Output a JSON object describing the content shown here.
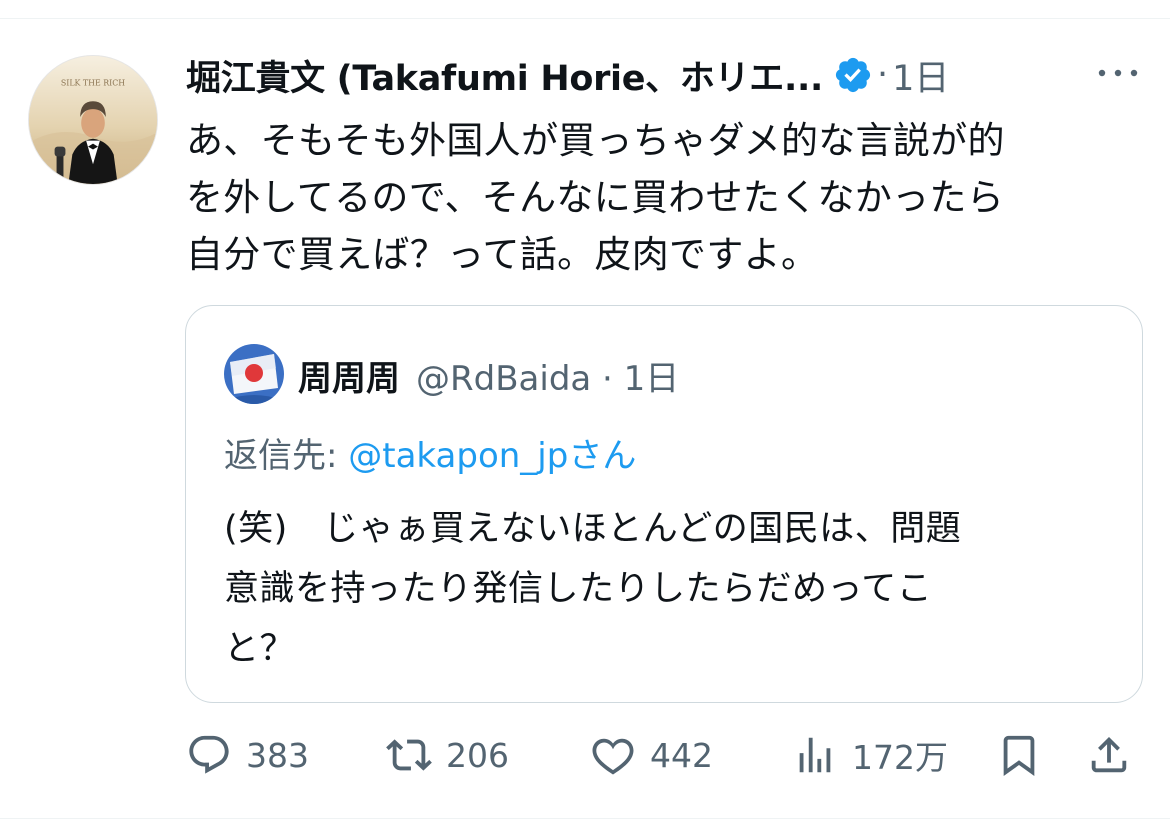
{
  "tweet": {
    "author_name": "堀江貴文 (Takafumi Horie、ホリエ...",
    "separator": "·",
    "time": "1日",
    "text": "あ、そもそも外国人が買っちゃダメ的な言説が的\nを外してるので、そんなに買わせたくなかったら\n自分で買えば？って話。皮肉ですよ。",
    "avatar_caption": "SILK THE RICH"
  },
  "quote": {
    "author_name": "周周周",
    "handle_time": "@RdBaida · 1日",
    "reply_prefix": "返信先: ",
    "reply_mention": "@takapon_jpさん",
    "text": "(笑)　じゃぁ買えないほとんどの国民は、問題\n意識を持ったり発信したりしたらだめってこ\nと？"
  },
  "actions": {
    "replies": "383",
    "retweets": "206",
    "likes": "442",
    "views": "172万"
  },
  "colors": {
    "text_primary": "#0f1419",
    "text_secondary": "#536471",
    "accent": "#1d9bf0",
    "border": "#cfd9de"
  },
  "icons": {
    "verified": "verified-badge-icon",
    "more": "more-dots-icon",
    "reply": "reply-bubble-icon",
    "retweet": "retweet-icon",
    "like": "heart-icon",
    "views": "bar-chart-icon",
    "bookmark": "bookmark-icon",
    "share": "share-icon"
  }
}
